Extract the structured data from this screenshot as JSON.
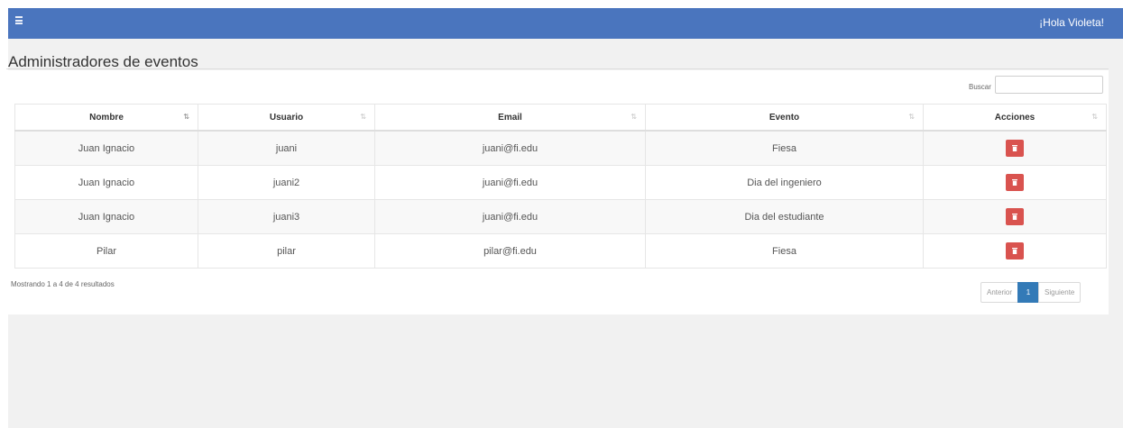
{
  "navbar": {
    "menu_icon": "hamburger-icon",
    "greeting": "¡Hola Violeta!"
  },
  "page": {
    "title": "Administradores de eventos"
  },
  "search": {
    "label": "Buscar",
    "value": ""
  },
  "table": {
    "columns": [
      "Nombre",
      "Usuario",
      "Email",
      "Evento",
      "Acciones"
    ],
    "sorted_column": "Nombre",
    "rows": [
      {
        "nombre": "Juan Ignacio",
        "usuario": "juani",
        "email": "juani@fi.edu",
        "evento": "Fiesa"
      },
      {
        "nombre": "Juan Ignacio",
        "usuario": "juani2",
        "email": "juani@fi.edu",
        "evento": "Dia del ingeniero"
      },
      {
        "nombre": "Juan Ignacio",
        "usuario": "juani3",
        "email": "juani@fi.edu",
        "evento": "Dia del estudiante"
      },
      {
        "nombre": "Pilar",
        "usuario": "pilar",
        "email": "pilar@fi.edu",
        "evento": "Fiesa"
      }
    ],
    "action_icon": "trash-icon"
  },
  "footer": {
    "info": "Mostrando 1 a 4 de 4 resultados"
  },
  "pagination": {
    "previous": "Anterior",
    "current": "1",
    "next": "Siguiente"
  },
  "colors": {
    "navbar": "#4a75be",
    "delete_button": "#d9534f",
    "active_page": "#337ab7"
  }
}
